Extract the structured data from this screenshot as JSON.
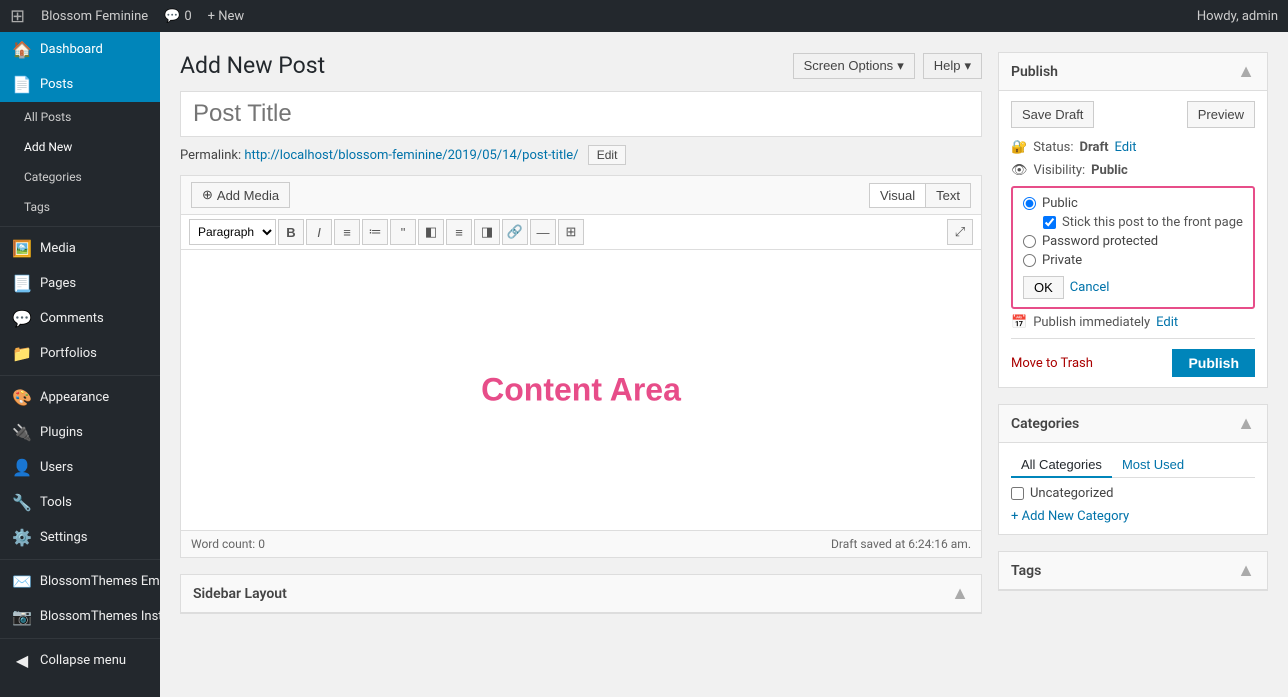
{
  "adminBar": {
    "site_name": "Blossom Feminine",
    "comments_count": "0",
    "new_label": "+ New",
    "howdy": "Howdy, admin"
  },
  "header": {
    "screen_options": "Screen Options",
    "help": "Help",
    "page_title": "Add New Post"
  },
  "sidebar": {
    "items": [
      {
        "id": "dashboard",
        "label": "Dashboard",
        "icon": "🏠"
      },
      {
        "id": "posts",
        "label": "Posts",
        "icon": "📄",
        "active": true
      },
      {
        "id": "all-posts",
        "label": "All Posts",
        "sub": true
      },
      {
        "id": "add-new",
        "label": "Add New",
        "sub": true,
        "active_sub": true
      },
      {
        "id": "categories",
        "label": "Categories",
        "sub": true
      },
      {
        "id": "tags",
        "label": "Tags",
        "sub": true
      },
      {
        "id": "media",
        "label": "Media",
        "icon": "🖼️"
      },
      {
        "id": "pages",
        "label": "Pages",
        "icon": "📃"
      },
      {
        "id": "comments",
        "label": "Comments",
        "icon": "💬"
      },
      {
        "id": "portfolios",
        "label": "Portfolios",
        "icon": "📁"
      },
      {
        "id": "appearance",
        "label": "Appearance",
        "icon": "🎨"
      },
      {
        "id": "plugins",
        "label": "Plugins",
        "icon": "🔌"
      },
      {
        "id": "users",
        "label": "Users",
        "icon": "👤"
      },
      {
        "id": "tools",
        "label": "Tools",
        "icon": "🔧"
      },
      {
        "id": "settings",
        "label": "Settings",
        "icon": "⚙️"
      },
      {
        "id": "blossom-email",
        "label": "BlossomThemes Email Newsletter",
        "icon": "✉️"
      },
      {
        "id": "blossom-instagram",
        "label": "BlossomThemes Instagram Feed",
        "icon": "📷"
      },
      {
        "id": "collapse",
        "label": "Collapse menu",
        "icon": "◀"
      }
    ]
  },
  "editor": {
    "post_title_placeholder": "Post Title",
    "permalink_label": "Permalink:",
    "permalink_url": "http://localhost/blossom-feminine/2019/05/14/post-title/",
    "edit_btn": "Edit",
    "add_media_btn": "Add Media",
    "visual_btn": "Visual",
    "text_btn": "Text",
    "paragraph_select": "Paragraph",
    "content_area_label": "Content Area",
    "word_count_label": "Word count:",
    "word_count": "0",
    "draft_saved": "Draft saved at 6:24:16 am."
  },
  "sidebarLayout": {
    "title": "Sidebar Layout"
  },
  "publish": {
    "title": "Publish",
    "save_draft": "Save Draft",
    "preview": "Preview",
    "status_label": "Status:",
    "status_value": "Draft",
    "status_edit": "Edit",
    "visibility_label": "Visibility:",
    "visibility_value": "Public",
    "public_radio": "Public",
    "stick_checkbox": "Stick this post to the front page",
    "password_protected": "Password protected",
    "private": "Private",
    "ok_btn": "OK",
    "cancel_btn": "Cancel",
    "publish_immediately": "Publish immediately",
    "publish_edit": "Edit",
    "move_to_trash": "Move to Trash",
    "publish_btn": "Publish"
  },
  "categories": {
    "title": "Categories",
    "all_tab": "All Categories",
    "most_used_tab": "Most Used",
    "uncategorized": "Uncategorized",
    "add_new": "+ Add New Category"
  },
  "tags": {
    "title": "Tags"
  }
}
